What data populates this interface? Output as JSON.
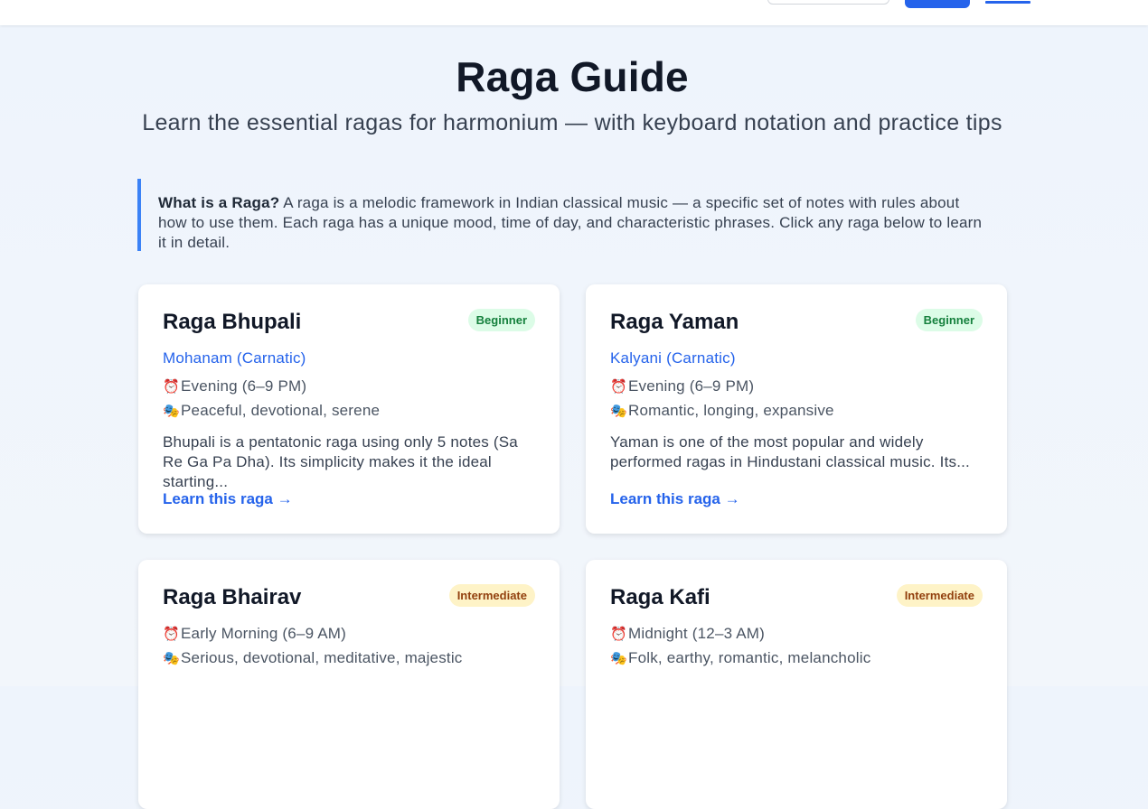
{
  "page": {
    "title": "Raga Guide",
    "subtitle": "Learn the essential ragas for harmonium — with keyboard notation and practice tips"
  },
  "intro": {
    "label": "What is a Raga?",
    "text": " A raga is a melodic framework in Indian classical music — a specific set of notes with rules about how to use them. Each raga has a unique mood, time of day, and characteristic phrases. Click any raga below to learn it in detail."
  },
  "icons": {
    "time": "alarm-clock-icon",
    "mood": "performing-arts-icon"
  },
  "colors": {
    "accent": "#2563eb",
    "beginner_bg": "#dcfce7",
    "beginner_text": "#15803d",
    "intermediate_bg": "#fef3c7",
    "intermediate_text": "#92400e"
  },
  "ragas": [
    {
      "name": "Raga Bhupali",
      "level": "Beginner",
      "alias": "Mohanam (Carnatic)",
      "time": "Evening (6–9 PM)",
      "mood": "Peaceful, devotional, serene",
      "description": "Bhupali is a pentatonic raga using only 5 notes (Sa Re Ga Pa Dha). Its simplicity makes it the ideal starting...",
      "link": "Learn this raga →"
    },
    {
      "name": "Raga Yaman",
      "level": "Beginner",
      "alias": "Kalyani (Carnatic)",
      "time": "Evening (6–9 PM)",
      "mood": "Romantic, longing, expansive",
      "description": "Yaman is one of the most popular and widely performed ragas in Hindustani classical music. Its...",
      "link": "Learn this raga →"
    },
    {
      "name": "Raga Bhairav",
      "level": "Intermediate",
      "time": "Early Morning (6–9 AM)",
      "mood": "Serious, devotional, meditative, majestic"
    },
    {
      "name": "Raga Kafi",
      "level": "Intermediate",
      "time": "Midnight (12–3 AM)",
      "mood": "Folk, earthy, romantic, melancholic"
    }
  ]
}
